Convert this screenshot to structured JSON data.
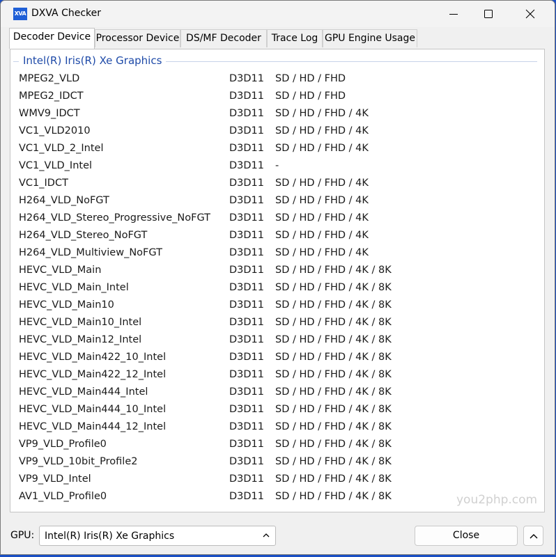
{
  "window": {
    "title": "DXVA Checker",
    "icon_text": "XVA"
  },
  "tabs": [
    {
      "label": "Decoder Device",
      "active": true
    },
    {
      "label": "Processor Device",
      "active": false
    },
    {
      "label": "DS/MF Decoder",
      "active": false
    },
    {
      "label": "Trace Log",
      "active": false
    },
    {
      "label": "GPU Engine Usage",
      "active": false
    }
  ],
  "group": {
    "title": "Intel(R) Iris(R) Xe Graphics"
  },
  "decoders": [
    {
      "name": "MPEG2_VLD",
      "api": "D3D11",
      "resolutions": "SD / HD / FHD"
    },
    {
      "name": "MPEG2_IDCT",
      "api": "D3D11",
      "resolutions": "SD / HD / FHD"
    },
    {
      "name": "WMV9_IDCT",
      "api": "D3D11",
      "resolutions": "SD / HD / FHD / 4K"
    },
    {
      "name": "VC1_VLD2010",
      "api": "D3D11",
      "resolutions": "SD / HD / FHD / 4K"
    },
    {
      "name": "VC1_VLD_2_Intel",
      "api": "D3D11",
      "resolutions": "SD / HD / FHD / 4K"
    },
    {
      "name": "VC1_VLD_Intel",
      "api": "D3D11",
      "resolutions": "-"
    },
    {
      "name": "VC1_IDCT",
      "api": "D3D11",
      "resolutions": "SD / HD / FHD / 4K"
    },
    {
      "name": "H264_VLD_NoFGT",
      "api": "D3D11",
      "resolutions": "SD / HD / FHD / 4K"
    },
    {
      "name": "H264_VLD_Stereo_Progressive_NoFGT",
      "api": "D3D11",
      "resolutions": "SD / HD / FHD / 4K"
    },
    {
      "name": "H264_VLD_Stereo_NoFGT",
      "api": "D3D11",
      "resolutions": "SD / HD / FHD / 4K"
    },
    {
      "name": "H264_VLD_Multiview_NoFGT",
      "api": "D3D11",
      "resolutions": "SD / HD / FHD / 4K"
    },
    {
      "name": "HEVC_VLD_Main",
      "api": "D3D11",
      "resolutions": "SD / HD / FHD / 4K / 8K"
    },
    {
      "name": "HEVC_VLD_Main_Intel",
      "api": "D3D11",
      "resolutions": "SD / HD / FHD / 4K / 8K"
    },
    {
      "name": "HEVC_VLD_Main10",
      "api": "D3D11",
      "resolutions": "SD / HD / FHD / 4K / 8K"
    },
    {
      "name": "HEVC_VLD_Main10_Intel",
      "api": "D3D11",
      "resolutions": "SD / HD / FHD / 4K / 8K"
    },
    {
      "name": "HEVC_VLD_Main12_Intel",
      "api": "D3D11",
      "resolutions": "SD / HD / FHD / 4K / 8K"
    },
    {
      "name": "HEVC_VLD_Main422_10_Intel",
      "api": "D3D11",
      "resolutions": "SD / HD / FHD / 4K / 8K"
    },
    {
      "name": "HEVC_VLD_Main422_12_Intel",
      "api": "D3D11",
      "resolutions": "SD / HD / FHD / 4K / 8K"
    },
    {
      "name": "HEVC_VLD_Main444_Intel",
      "api": "D3D11",
      "resolutions": "SD / HD / FHD / 4K / 8K"
    },
    {
      "name": "HEVC_VLD_Main444_10_Intel",
      "api": "D3D11",
      "resolutions": "SD / HD / FHD / 4K / 8K"
    },
    {
      "name": "HEVC_VLD_Main444_12_Intel",
      "api": "D3D11",
      "resolutions": "SD / HD / FHD / 4K / 8K"
    },
    {
      "name": "VP9_VLD_Profile0",
      "api": "D3D11",
      "resolutions": "SD / HD / FHD / 4K / 8K"
    },
    {
      "name": "VP9_VLD_10bit_Profile2",
      "api": "D3D11",
      "resolutions": "SD / HD / FHD / 4K / 8K"
    },
    {
      "name": "VP9_VLD_Intel",
      "api": "D3D11",
      "resolutions": "SD / HD / FHD / 4K / 8K"
    },
    {
      "name": "AV1_VLD_Profile0",
      "api": "D3D11",
      "resolutions": "SD / HD / FHD / 4K / 8K"
    }
  ],
  "watermark": "you2php.com",
  "footer": {
    "gpu_label": "GPU:",
    "gpu_selected": "Intel(R) Iris(R) Xe Graphics",
    "close_label": "Close"
  },
  "icons": {
    "minimize": "minimize-icon",
    "maximize": "maximize-icon",
    "close": "close-icon",
    "dropdown": "chevron-up-icon",
    "expand": "chevron-up-icon"
  }
}
